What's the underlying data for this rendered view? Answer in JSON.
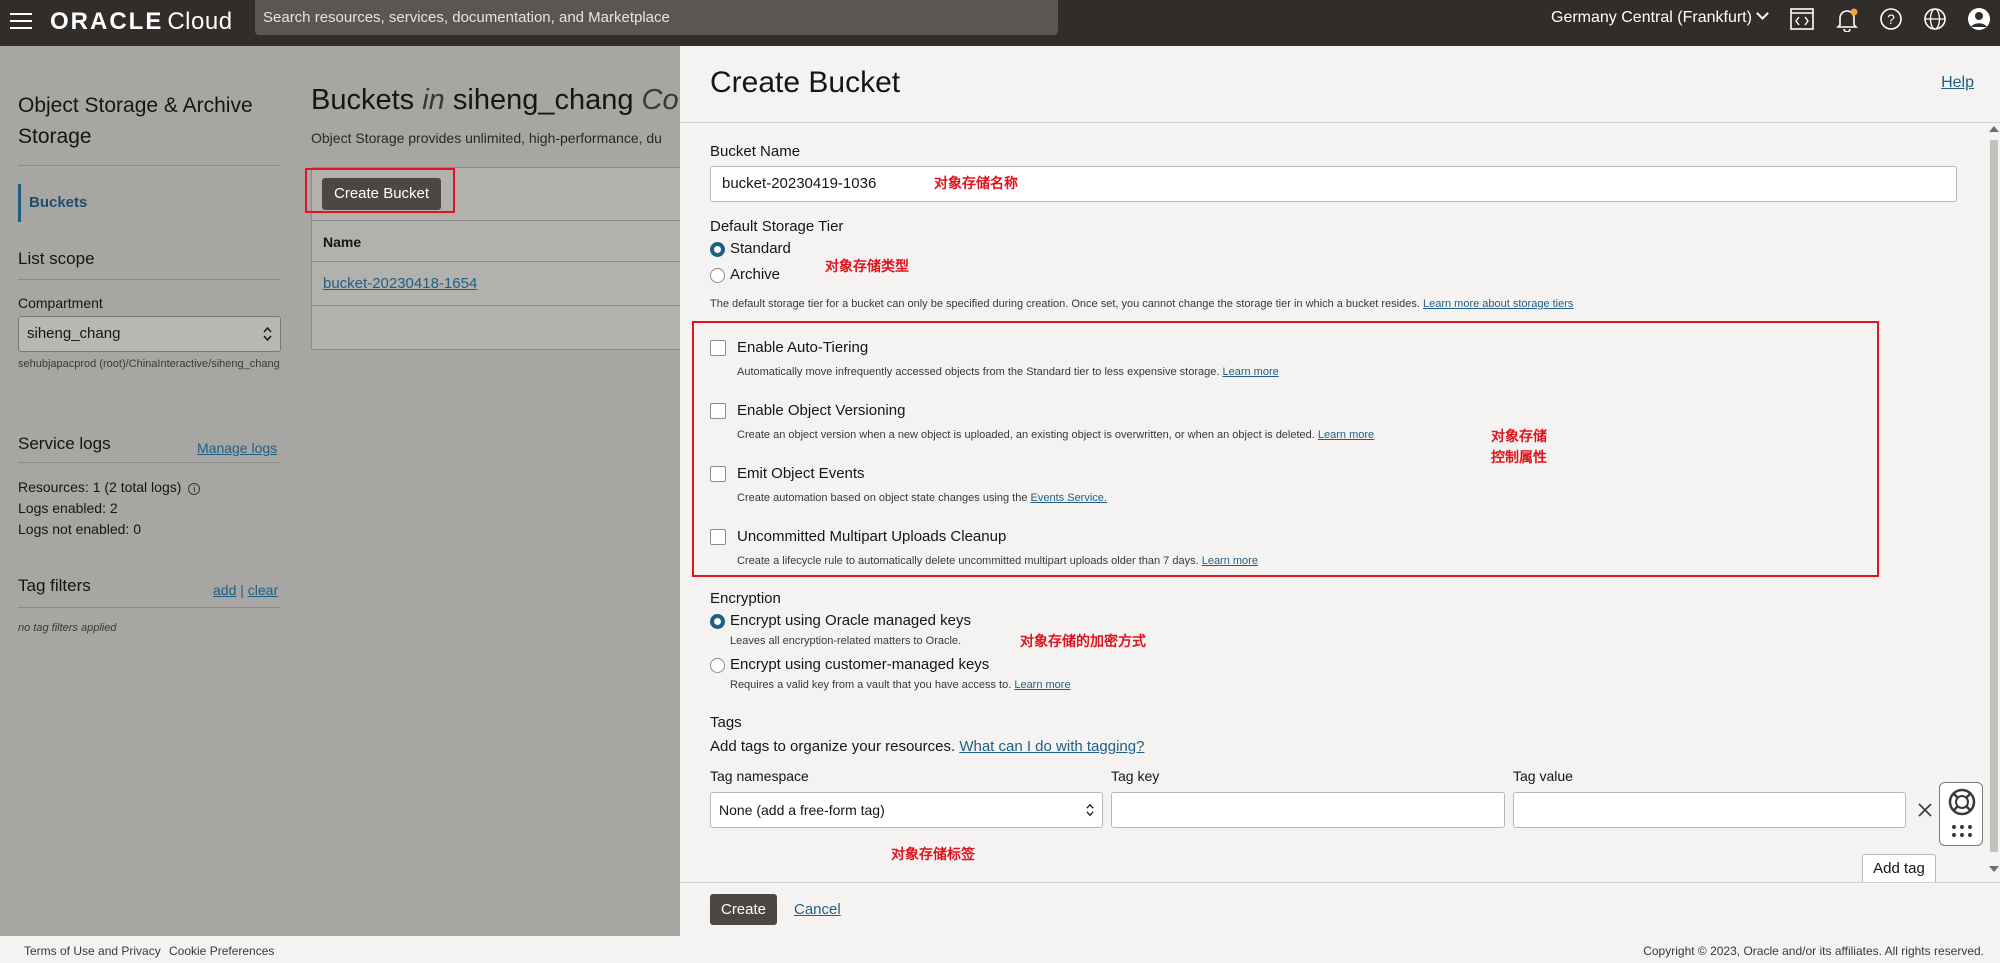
{
  "topbar": {
    "logo_brand": "ORACLE",
    "logo_product": "Cloud",
    "search_placeholder": "Search resources, services, documentation, and Marketplace",
    "region": "Germany Central (Frankfurt)",
    "icons": [
      "hamburger-menu-icon",
      "code-editor-icon",
      "bell-icon",
      "help-icon",
      "globe-icon",
      "user-icon"
    ]
  },
  "leftnav": {
    "service_title": "Object Storage & Archive Storage",
    "selected_item": "Buckets",
    "list_scope": "List scope",
    "compartment_label": "Compartment",
    "compartment_value": "siheng_chang",
    "compartment_path": "sehubjapacprod (root)/ChinaInteractive/siheng_chang",
    "service_logs_title": "Service logs",
    "manage_logs": "Manage logs",
    "resources": "Resources:  1 (2 total logs)",
    "logs_enabled": "Logs enabled:  2",
    "logs_not_enabled": "Logs not enabled:  0",
    "tag_filters_title": "Tag filters",
    "tag_add": "add",
    "tag_sep": "|",
    "tag_clear": "clear",
    "no_tag_filters": "no tag filters applied"
  },
  "main": {
    "title_prefix": "Buckets",
    "title_in": "in",
    "title_compartment": "siheng_chang",
    "title_suffix": "Co",
    "description": "Object Storage provides unlimited, high-performance, du",
    "create_bucket_button": "Create Bucket",
    "table_header_name": "Name",
    "rows": [
      "bucket-20230418-1654"
    ]
  },
  "drawer": {
    "title": "Create Bucket",
    "help": "Help",
    "bucket_name_label": "Bucket Name",
    "bucket_name_value": "bucket-20230419-1036",
    "storage_tier_label": "Default Storage Tier",
    "tier_standard": "Standard",
    "tier_archive": "Archive",
    "tier_selected": "Standard",
    "tier_hint": "The default storage tier for a bucket can only be specified during creation. Once set, you cannot change the storage tier in which a bucket resides.",
    "tier_hint_link": "Learn more about storage tiers",
    "options": [
      {
        "label": "Enable Auto-Tiering",
        "desc": "Automatically move infrequently accessed objects from the Standard tier to less expensive storage.",
        "link": "Learn more"
      },
      {
        "label": "Enable Object Versioning",
        "desc": "Create an object version when a new object is uploaded, an existing object is overwritten, or when an object is deleted.",
        "link": "Learn more"
      },
      {
        "label": "Emit Object Events",
        "desc": "Create automation based on object state changes using the",
        "link": "Events Service."
      },
      {
        "label": "Uncommitted Multipart Uploads Cleanup",
        "desc": "Create a lifecycle rule to automatically delete uncommitted multipart uploads older than 7 days.",
        "link": "Learn more"
      }
    ],
    "encryption_label": "Encryption",
    "enc_oracle": "Encrypt using Oracle managed keys",
    "enc_oracle_hint": "Leaves all encryption-related matters to Oracle.",
    "enc_customer": "Encrypt using customer-managed keys",
    "enc_customer_hint": "Requires a valid key from a vault that you have access to.",
    "enc_customer_link": "Learn more",
    "tags_label": "Tags",
    "tags_hint": "Add tags to organize your resources.",
    "tags_link": "What can I do with tagging?",
    "tag_namespace_label": "Tag namespace",
    "tag_namespace_value": "None (add a free-form tag)",
    "tag_key_label": "Tag key",
    "tag_value_label": "Tag value",
    "add_tag": "Add tag",
    "create": "Create",
    "cancel": "Cancel"
  },
  "annotations": {
    "name": "对象存储名称",
    "type": "对象存储类型",
    "control_1": "对象存储",
    "control_2": "控制属性",
    "encryption": "对象存储的加密方式",
    "tags": "对象存储标签",
    "color": "#e0141e"
  },
  "footer": {
    "terms": "Terms of Use and Privacy",
    "cookies": "Cookie Preferences",
    "copyright": "Copyright © 2023, Oracle and/or its affiliates. All rights reserved."
  },
  "colors": {
    "topbar": "#312d2a",
    "accent": "#1f5f86",
    "button_dark": "#4b4744",
    "drawer_bg": "#f4f3f1"
  }
}
